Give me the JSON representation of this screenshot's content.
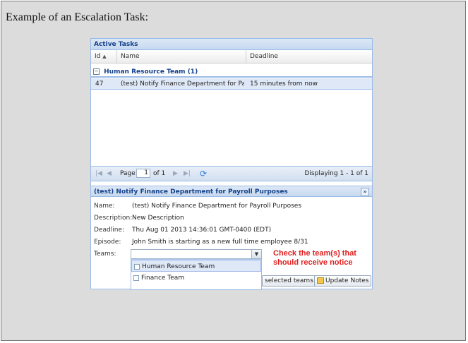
{
  "page": {
    "title": "Example of an Escalation Task:"
  },
  "panel": {
    "title": "Active Tasks",
    "columns": {
      "id": "Id",
      "name": "Name",
      "deadline": "Deadline"
    },
    "group": {
      "toggle": "−",
      "label": "Human Resource Team (1)"
    },
    "rows": [
      {
        "id": "47",
        "name": "(test) Notify Finance Department for Payr...",
        "deadline": "15 minutes from now"
      }
    ],
    "paging": {
      "page_label": "Page",
      "page_value": "1",
      "of_label": "of 1",
      "display": "Displaying 1 - 1 of 1"
    }
  },
  "detail": {
    "title": "(test) Notify Finance Department for Payroll Purposes",
    "fields": {
      "name_label": "Name:",
      "name_value": "(test) Notify Finance Department for Payroll Purposes",
      "description_label": "Description:",
      "description_value": "New Description",
      "deadline_label": "Deadline:",
      "deadline_value": "Thu Aug 01 2013 14:36:01 GMT-0400 (EDT)",
      "episode_label": "Episode:",
      "episode_value": "John Smith is starting as a new full time employee 8/31",
      "teams_label": "Teams:"
    },
    "team_options": [
      {
        "label": "Human Resource Team"
      },
      {
        "label": "Finance Team"
      }
    ],
    "note": "Check the team(s) that should receive notice",
    "buttons": {
      "notify_label": "selected teams",
      "update_label": "Update Notes"
    }
  }
}
